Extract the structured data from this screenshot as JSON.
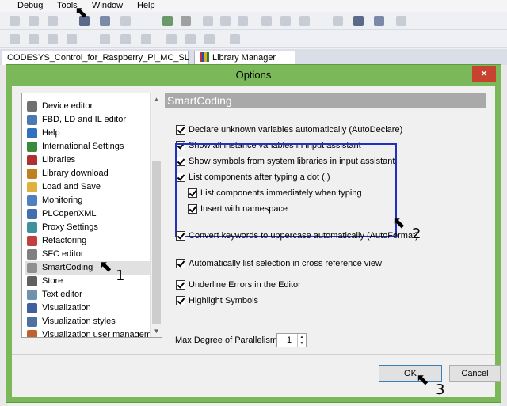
{
  "menu": {
    "items": [
      "Debug",
      "Tools",
      "Window",
      "Help"
    ]
  },
  "tabs": [
    {
      "label": "CODESYS_Control_for_Raspberry_Pi_MC_SL"
    },
    {
      "label": "Library Manager"
    }
  ],
  "dialog": {
    "title": "Options",
    "close_glyph": "×",
    "categories": [
      {
        "label": "Device editor",
        "icon": "device-editor-icon",
        "color": "#707070"
      },
      {
        "label": "FBD, LD and IL editor",
        "icon": "fbd-editor-icon",
        "color": "#4a7ab0"
      },
      {
        "label": "Help",
        "icon": "help-icon",
        "color": "#3070c0"
      },
      {
        "label": "International Settings",
        "icon": "globe-icon",
        "color": "#3a8a3a"
      },
      {
        "label": "Libraries",
        "icon": "library-icon",
        "color": "#b03030"
      },
      {
        "label": "Library download",
        "icon": "library-download-icon",
        "color": "#c08020"
      },
      {
        "label": "Load and Save",
        "icon": "folder-icon",
        "color": "#e0b040"
      },
      {
        "label": "Monitoring",
        "icon": "monitoring-icon",
        "color": "#5080c0"
      },
      {
        "label": "PLCopenXML",
        "icon": "plcopenxml-icon",
        "color": "#4070b0"
      },
      {
        "label": "Proxy Settings",
        "icon": "proxy-icon",
        "color": "#4090a0"
      },
      {
        "label": "Refactoring",
        "icon": "refactoring-icon",
        "color": "#c04040"
      },
      {
        "label": "SFC editor",
        "icon": "sfc-editor-icon",
        "color": "#808080"
      },
      {
        "label": "SmartCoding",
        "icon": "smartcoding-icon",
        "color": "#909090"
      },
      {
        "label": "Store",
        "icon": "store-icon",
        "color": "#606060"
      },
      {
        "label": "Text editor",
        "icon": "text-editor-icon",
        "color": "#7090b0"
      },
      {
        "label": "Visualization",
        "icon": "visualization-icon",
        "color": "#4060a0"
      },
      {
        "label": "Visualization styles",
        "icon": "visualization-styles-icon",
        "color": "#5070a0"
      },
      {
        "label": "Visualization user management",
        "icon": "user-management-icon",
        "color": "#c06030"
      }
    ],
    "selected_category": "SmartCoding",
    "section_title": "SmartCoding",
    "options": [
      {
        "label": "Declare unknown variables automatically (AutoDeclare)",
        "checked": true
      },
      {
        "label": "Show all instance variables in input assistant",
        "checked": true
      },
      {
        "label": "Show symbols from system libraries in input assistant",
        "checked": true
      },
      {
        "label": "List components after typing a dot (.)",
        "checked": true
      },
      {
        "label": "List components immediately when typing",
        "checked": true
      },
      {
        "label": "Insert with namespace",
        "checked": true
      },
      {
        "label": "Convert keywords to uppercase automatically (AutoFormat)",
        "checked": true
      },
      {
        "label": "Automatically list selection in cross reference view",
        "checked": true
      },
      {
        "label": "Underline Errors in the Editor",
        "checked": true
      },
      {
        "label": "Highlight Symbols",
        "checked": true
      }
    ],
    "max_parallelism": {
      "label": "Max Degree of Parallelism",
      "value": "1"
    },
    "buttons": {
      "ok": "OK",
      "cancel": "Cancel"
    }
  },
  "annotations": [
    "1",
    "2",
    "3"
  ],
  "colors": {
    "dialog_frame": "#7ab85a",
    "close_button": "#c84232",
    "highlight_box": "#2030c0",
    "section_header": "#a9a9a9"
  }
}
